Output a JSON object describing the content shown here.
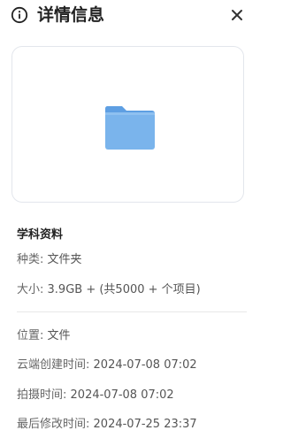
{
  "header": {
    "title": "详情信息",
    "info_icon": "info-circle-icon",
    "close_icon": "close-icon"
  },
  "preview": {
    "icon": "folder-icon",
    "folder_color": "#7ab4ec"
  },
  "file": {
    "name": "学科资料"
  },
  "details": {
    "type_label": "种类:",
    "type_value": "文件夹",
    "size_label": "大小:",
    "size_value": "3.9GB + (共5000 + 个项目)",
    "location_label": "位置:",
    "location_value": "文件",
    "created_label": "云端创建时间:",
    "created_value": "2024-07-08 07:02",
    "shot_label": "拍摄时间:",
    "shot_value": "2024-07-08 07:02",
    "modified_label": "最后修改时间:",
    "modified_value": "2024-07-25 23:37"
  }
}
